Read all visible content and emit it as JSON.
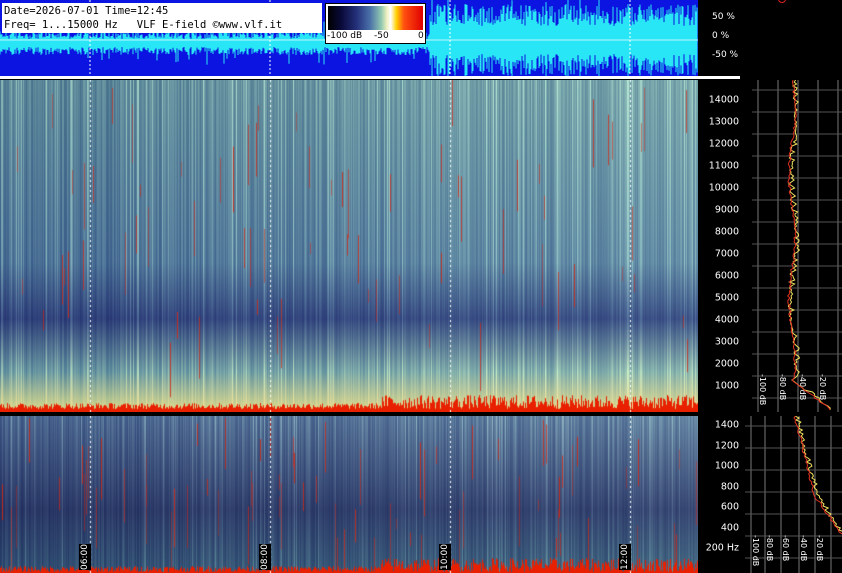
{
  "info": {
    "line1": "Date=2026-07-01 Time=12:45",
    "line2": "Freq= 1...15000 Hz   VLF E-field ©www.vlf.it"
  },
  "colorbar": {
    "labels": [
      "-100 dB",
      "-50",
      "0"
    ]
  },
  "waveform_scale": [
    "50 %",
    "0 %",
    "-50 %"
  ],
  "main_axis": {
    "unit": "",
    "ticks": [
      "14000",
      "13000",
      "12000",
      "11000",
      "10000",
      "9000",
      "8000",
      "7000",
      "6000",
      "5000",
      "4000",
      "3000",
      "2000",
      "1000"
    ]
  },
  "low_axis": {
    "ticks": [
      "1400",
      "1200",
      "1000",
      "800",
      "600",
      "400",
      "200 Hz"
    ]
  },
  "main_profile_db_labels": [
    "-100 dB",
    "-80 dB",
    "-40 dB",
    "-20 dB"
  ],
  "low_profile_db_labels": [
    "-100 dB",
    "-80 dB",
    "-60 dB",
    "-40 dB",
    "-20 dB"
  ],
  "time_labels": [
    "06:00",
    "08:00",
    "10:00",
    "12:00"
  ],
  "colors": {
    "waveform_bg": "#0b14e0",
    "waveform_trace": "#28e6f5",
    "spectrogram_base": "#1a2a6a",
    "hot": "#e82000"
  }
}
